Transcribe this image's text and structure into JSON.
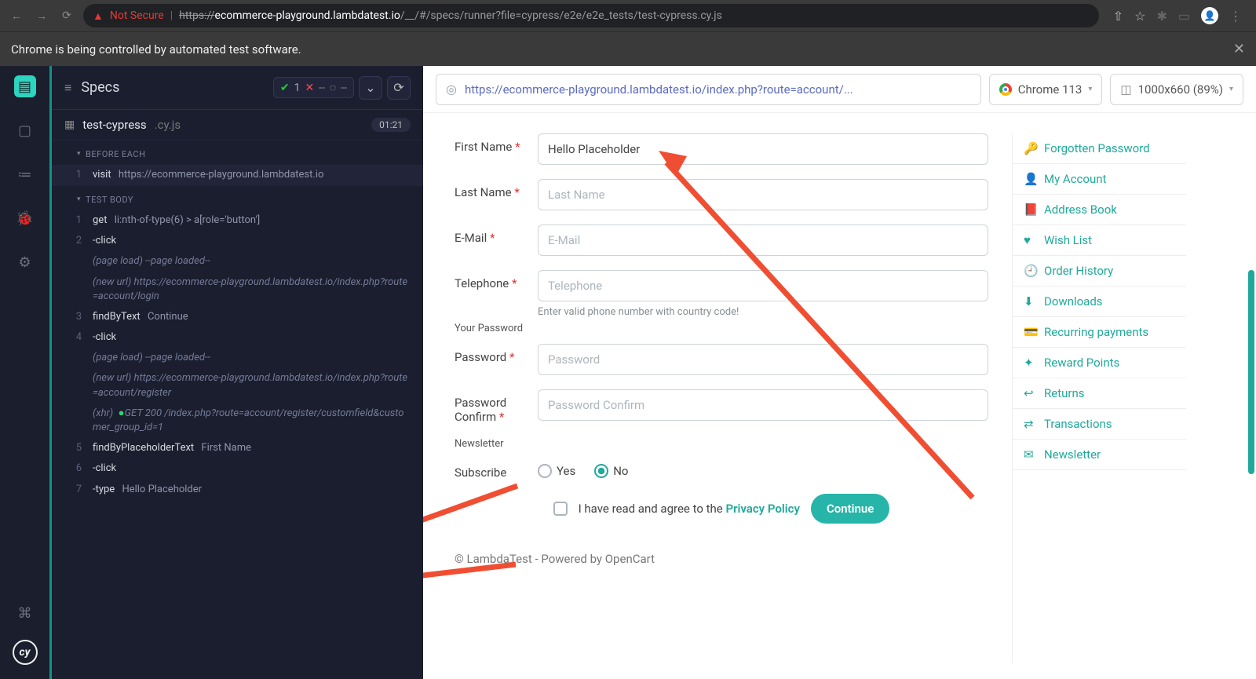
{
  "browser": {
    "not_secure": "Not Secure",
    "url_prefix": "https://",
    "url_host": "ecommerce-playground.lambdatest.io",
    "url_path": "/__/#/specs/runner?file=cypress/e2e/e2e_tests/test-cypress.cy.js"
  },
  "automation_banner": "Chrome is being controlled by automated test software.",
  "specs": {
    "title": "Specs",
    "pass_count": "1",
    "fail_count": "--",
    "pending": "--",
    "file_name": "test-cypress",
    "file_ext": ".cy.js",
    "duration": "01:21",
    "before_each": "BEFORE EACH",
    "test_body": "TEST BODY",
    "rows": [
      {
        "n": "1",
        "cmd": "visit",
        "arg": "https://ecommerce-playground.lambdatest.io"
      },
      {
        "section": "TEST BODY"
      },
      {
        "n": "1",
        "cmd": "get",
        "arg": "li:nth-of-type(6) > a[role='button']"
      },
      {
        "n": "2",
        "cmd": "-click",
        "arg": ""
      },
      {
        "info": "(page load)  --page loaded--"
      },
      {
        "info": "(new url)  https://ecommerce-playground.lambdatest.io/index.php?route=account/login"
      },
      {
        "n": "3",
        "cmd": "findByText",
        "arg": "Continue"
      },
      {
        "n": "4",
        "cmd": "-click",
        "arg": ""
      },
      {
        "info": "(page load)  --page loaded--"
      },
      {
        "info": "(new url)  https://ecommerce-playground.lambdatest.io/index.php?route=account/register"
      },
      {
        "xhr": "(xhr)",
        "status": "GET 200",
        "path": "/index.php?route=account/register/customfield&customer_group_id=1"
      },
      {
        "n": "5",
        "cmd": "findByPlaceholderText",
        "arg": "First Name"
      },
      {
        "n": "6",
        "cmd": "-click",
        "arg": ""
      },
      {
        "n": "7",
        "cmd": "-type",
        "arg": "Hello Placeholder"
      }
    ]
  },
  "aut": {
    "url": "https://ecommerce-playground.lambdatest.io/index.php?route=account/...",
    "browser_chip": "Chrome 113",
    "viewport_chip": "1000x660 (89%)",
    "form": {
      "first_name_label": "First Name",
      "first_name_value": "Hello Placeholder",
      "last_name_label": "Last Name",
      "last_name_ph": "Last Name",
      "email_label": "E-Mail",
      "email_ph": "E-Mail",
      "tel_label": "Telephone",
      "tel_ph": "Telephone",
      "tel_helper": "Enter valid phone number with country code!",
      "your_password": "Your Password",
      "password_label": "Password",
      "password_ph": "Password",
      "confirm_label": "Password Confirm",
      "confirm_ph": "Password Confirm",
      "newsletter": "Newsletter",
      "subscribe": "Subscribe",
      "yes": "Yes",
      "no": "No",
      "agree_pre": "I have read and agree to the ",
      "agree_link": "Privacy Policy",
      "continue": "Continue",
      "footer": "© LambdaTest - Powered by OpenCart"
    },
    "sidebar": [
      {
        "icon": "🔑",
        "label": "Forgotten Password"
      },
      {
        "icon": "👤",
        "label": "My Account"
      },
      {
        "icon": "📕",
        "label": "Address Book"
      },
      {
        "icon": "♥",
        "label": "Wish List"
      },
      {
        "icon": "🕘",
        "label": "Order History"
      },
      {
        "icon": "⬇",
        "label": "Downloads"
      },
      {
        "icon": "💳",
        "label": "Recurring payments"
      },
      {
        "icon": "✦",
        "label": "Reward Points"
      },
      {
        "icon": "↩",
        "label": "Returns"
      },
      {
        "icon": "⇄",
        "label": "Transactions"
      },
      {
        "icon": "✉",
        "label": "Newsletter"
      }
    ]
  }
}
